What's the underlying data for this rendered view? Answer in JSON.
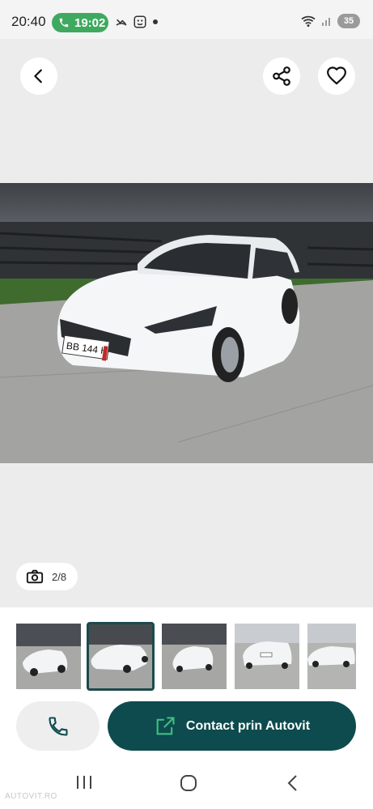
{
  "status_bar": {
    "time": "20:40",
    "call_time": "19:02",
    "battery": "35"
  },
  "gallery": {
    "counter": "2/8"
  },
  "actions": {
    "contact_label": "Contact prin Autovit"
  },
  "car": {
    "plate": "BB 144 H"
  },
  "watermark": "AUTOVIT.RO",
  "colors": {
    "accent": "#0d4b4e",
    "call_pill": "#3fa95f",
    "gallery_bg": "#ececec"
  },
  "icons": [
    "back-arrow-icon",
    "share-icon",
    "heart-icon",
    "camera-icon",
    "phone-icon",
    "external-link-icon"
  ]
}
